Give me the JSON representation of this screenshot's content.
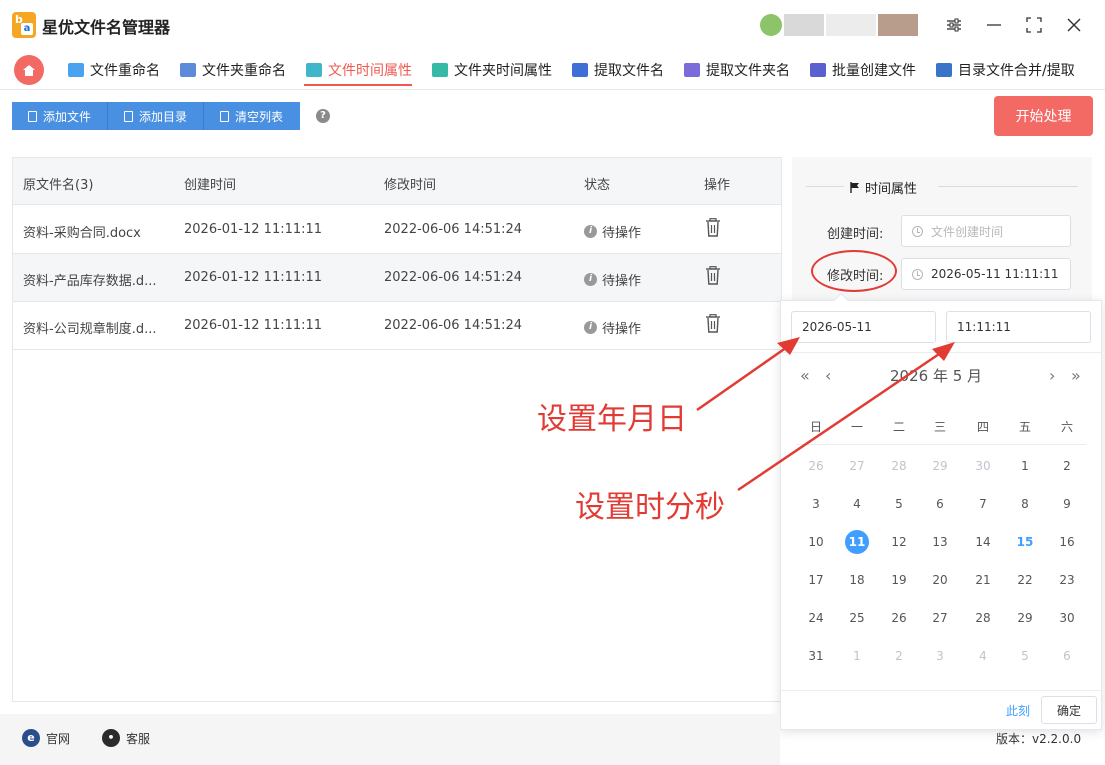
{
  "app": {
    "title": "星优文件名管理器",
    "logo_b": "b",
    "logo_a": "a"
  },
  "tabs": [
    {
      "label": "文件重命名",
      "color": "#4aa3f0"
    },
    {
      "label": "文件夹重命名",
      "color": "#5b8bd9"
    },
    {
      "label": "文件时间属性",
      "color": "#3fb6c9",
      "active": true
    },
    {
      "label": "文件夹时间属性",
      "color": "#37b9a8"
    },
    {
      "label": "提取文件名",
      "color": "#3d6fd6"
    },
    {
      "label": "提取文件夹名",
      "color": "#7b6cd9"
    },
    {
      "label": "批量创建文件",
      "color": "#5b5fd0"
    },
    {
      "label": "目录文件合并/提取",
      "color": "#3a74c9"
    }
  ],
  "toolbar": {
    "add_file": "添加文件",
    "add_dir": "添加目录",
    "clear_list": "清空列表",
    "help": "?",
    "start": "开始处理"
  },
  "table": {
    "headers": [
      "原文件名(3)",
      "创建时间",
      "修改时间",
      "状态",
      "操作"
    ],
    "rows": [
      {
        "name": "资料-采购合同.docx",
        "created": "2026-01-12 11:11:11",
        "modified": "2022-06-06 14:51:24",
        "status": "待操作"
      },
      {
        "name": "资料-产品库存数据.d...",
        "created": "2026-01-12 11:11:11",
        "modified": "2022-06-06 14:51:24",
        "status": "待操作"
      },
      {
        "name": "资料-公司规章制度.d...",
        "created": "2026-01-12 11:11:11",
        "modified": "2022-06-06 14:51:24",
        "status": "待操作"
      }
    ]
  },
  "panel": {
    "title": "时间属性",
    "created_label": "创建时间:",
    "created_placeholder": "文件创建时间",
    "modified_label": "修改时间:",
    "modified_value": "2026-05-11 11:11:11"
  },
  "picker": {
    "date_value": "2026-05-11",
    "time_value": "11:11:11",
    "nav_prev_year": "«",
    "nav_prev_month": "‹",
    "nav_next_month": "›",
    "nav_next_year": "»",
    "month_label": "2026 年  5 月",
    "weekdays": [
      "日",
      "一",
      "二",
      "三",
      "四",
      "五",
      "六"
    ],
    "days": [
      [
        "26",
        "27",
        "28",
        "29",
        "30",
        "1",
        "2"
      ],
      [
        "3",
        "4",
        "5",
        "6",
        "7",
        "8",
        "9"
      ],
      [
        "10",
        "11",
        "12",
        "13",
        "14",
        "15",
        "16"
      ],
      [
        "17",
        "18",
        "19",
        "20",
        "21",
        "22",
        "23"
      ],
      [
        "24",
        "25",
        "26",
        "27",
        "28",
        "29",
        "30"
      ],
      [
        "31",
        "1",
        "2",
        "3",
        "4",
        "5",
        "6"
      ]
    ],
    "selected_day": "11",
    "today_day": "15",
    "now": "此刻",
    "ok": "确定"
  },
  "annotations": {
    "date": "设置年月日",
    "time": "设置时分秒"
  },
  "footer": {
    "website": "官网",
    "service": "客服",
    "version": "版本：v2.2.0.0"
  }
}
